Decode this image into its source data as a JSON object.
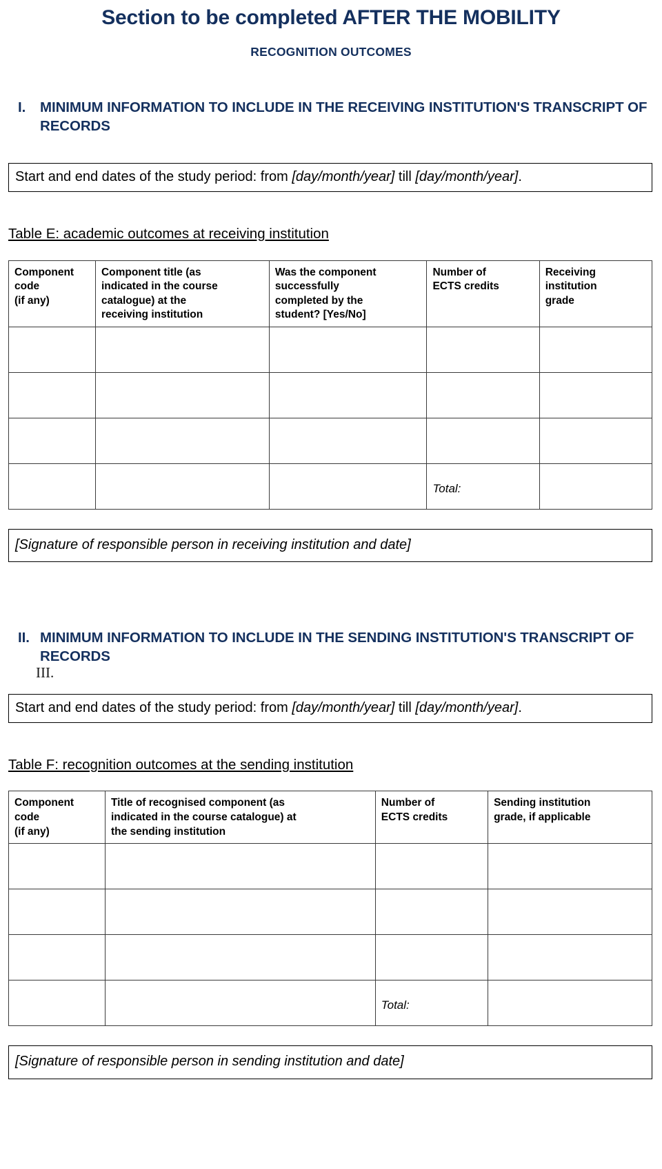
{
  "document": {
    "title": "Section to be completed AFTER THE MOBILITY",
    "subtitle": "RECOGNITION OUTCOMES",
    "accent_color": "#14305E",
    "border_color": "#3A3A3A"
  },
  "section_one": {
    "number": "I.",
    "heading": "MINIMUM INFORMATION TO INCLUDE IN THE RECEIVING INSTITUTION'S TRANSCRIPT OF RECORDS",
    "dates_box": {
      "lead": "Start and end dates of the study period: from",
      "placeholder_from": "[day/month/year]",
      "middle": "till",
      "placeholder_till": "[day/month/year]",
      "trailing": "."
    },
    "table_caption": "Table E: academic outcomes at receiving institution",
    "table": {
      "headers": [
        "Component\ncode\n(if any)",
        "Component title (as indicated in the course catalogue) at the receiving institution",
        "Was the component successfully completed by the student? [Yes/No]",
        "Number of ECTS credits",
        "Receiving institution grade"
      ],
      "header_lines": [
        [
          "Component",
          "code",
          "(if any)"
        ],
        [
          "Component title (as",
          "indicated in the course",
          "catalogue) at the",
          "receiving institution"
        ],
        [
          "Was the component",
          "successfully",
          "completed by the",
          "student? [Yes/No]"
        ],
        [
          "Number of",
          "ECTS credits"
        ],
        [
          "Receiving",
          "institution",
          "grade"
        ]
      ],
      "empty_row_count": 3,
      "total_label": "Total:",
      "total_value": "",
      "total_label_column_index": 3
    },
    "signature_box": "[Signature of responsible person in receiving institution and date]"
  },
  "section_two": {
    "number": "II.",
    "heading": "MINIMUM INFORMATION TO INCLUDE IN THE SENDING INSTITUTION'S TRANSCRIPT OF RECORDS",
    "stray_numeral": "III.",
    "dates_box": {
      "lead": "Start and end dates of the study period: from",
      "placeholder_from": "[day/month/year]",
      "middle": "till",
      "placeholder_till": "[day/month/year]",
      "trailing": "."
    },
    "table_caption": "Table F:  recognition outcomes at the sending institution",
    "table": {
      "headers": [
        "Component code (if any)",
        "Title of recognised component (as indicated in the course catalogue) at the sending institution",
        "Number of ECTS credits",
        "Sending institution grade, if applicable"
      ],
      "header_lines": [
        [
          "Component",
          "code",
          "(if any)"
        ],
        [
          "Title of recognised component (as",
          "indicated in the course catalogue) at",
          "the sending institution"
        ],
        [
          "Number of",
          "ECTS credits"
        ],
        [
          "Sending institution",
          "grade, if applicable"
        ]
      ],
      "empty_row_count": 3,
      "total_label": "Total:",
      "total_value": "",
      "total_label_column_index": 2
    },
    "signature_box": "[Signature of responsible person in sending institution and date]"
  }
}
